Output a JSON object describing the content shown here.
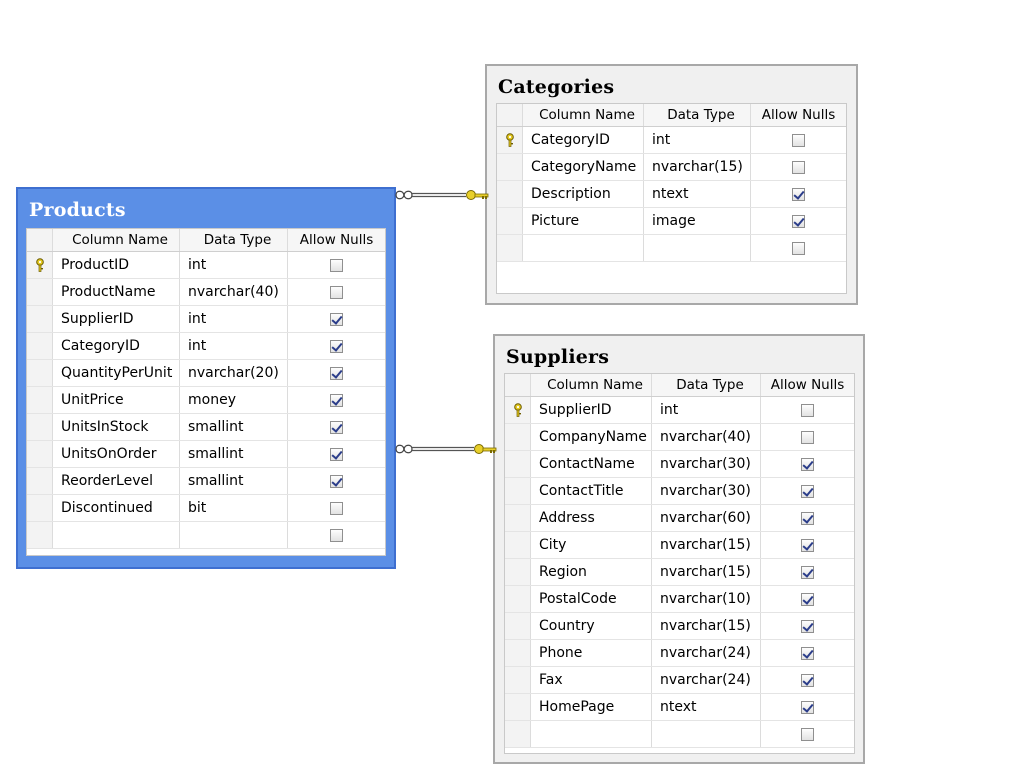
{
  "headers": {
    "column_name": "Column Name",
    "data_type": "Data Type",
    "allow_nulls": "Allow Nulls"
  },
  "tables": {
    "categories": {
      "title": "Categories",
      "rows": [
        {
          "name": "CategoryID",
          "type": "int",
          "nulls": false,
          "pk": true
        },
        {
          "name": "CategoryName",
          "type": "nvarchar(15)",
          "nulls": false,
          "pk": false
        },
        {
          "name": "Description",
          "type": "ntext",
          "nulls": true,
          "pk": false
        },
        {
          "name": "Picture",
          "type": "image",
          "nulls": true,
          "pk": false
        },
        {
          "name": "",
          "type": "",
          "nulls": false,
          "pk": false
        }
      ]
    },
    "products": {
      "title": "Products",
      "selected": true,
      "rows": [
        {
          "name": "ProductID",
          "type": "int",
          "nulls": false,
          "pk": true
        },
        {
          "name": "ProductName",
          "type": "nvarchar(40)",
          "nulls": false,
          "pk": false
        },
        {
          "name": "SupplierID",
          "type": "int",
          "nulls": true,
          "pk": false
        },
        {
          "name": "CategoryID",
          "type": "int",
          "nulls": true,
          "pk": false
        },
        {
          "name": "QuantityPerUnit",
          "type": "nvarchar(20)",
          "nulls": true,
          "pk": false
        },
        {
          "name": "UnitPrice",
          "type": "money",
          "nulls": true,
          "pk": false
        },
        {
          "name": "UnitsInStock",
          "type": "smallint",
          "nulls": true,
          "pk": false
        },
        {
          "name": "UnitsOnOrder",
          "type": "smallint",
          "nulls": true,
          "pk": false
        },
        {
          "name": "ReorderLevel",
          "type": "smallint",
          "nulls": true,
          "pk": false
        },
        {
          "name": "Discontinued",
          "type": "bit",
          "nulls": false,
          "pk": false
        },
        {
          "name": "",
          "type": "",
          "nulls": false,
          "pk": false
        }
      ]
    },
    "suppliers": {
      "title": "Suppliers",
      "rows": [
        {
          "name": "SupplierID",
          "type": "int",
          "nulls": false,
          "pk": true
        },
        {
          "name": "CompanyName",
          "type": "nvarchar(40)",
          "nulls": false,
          "pk": false
        },
        {
          "name": "ContactName",
          "type": "nvarchar(30)",
          "nulls": true,
          "pk": false
        },
        {
          "name": "ContactTitle",
          "type": "nvarchar(30)",
          "nulls": true,
          "pk": false
        },
        {
          "name": "Address",
          "type": "nvarchar(60)",
          "nulls": true,
          "pk": false
        },
        {
          "name": "City",
          "type": "nvarchar(15)",
          "nulls": true,
          "pk": false
        },
        {
          "name": "Region",
          "type": "nvarchar(15)",
          "nulls": true,
          "pk": false
        },
        {
          "name": "PostalCode",
          "type": "nvarchar(10)",
          "nulls": true,
          "pk": false
        },
        {
          "name": "Country",
          "type": "nvarchar(15)",
          "nulls": true,
          "pk": false
        },
        {
          "name": "Phone",
          "type": "nvarchar(24)",
          "nulls": true,
          "pk": false
        },
        {
          "name": "Fax",
          "type": "nvarchar(24)",
          "nulls": true,
          "pk": false
        },
        {
          "name": "HomePage",
          "type": "ntext",
          "nulls": true,
          "pk": false
        },
        {
          "name": "",
          "type": "",
          "nulls": false,
          "pk": false
        }
      ]
    }
  },
  "relationships": [
    {
      "from": "products",
      "to": "categories",
      "many_end": "infinity-icon",
      "one_end": "key-icon"
    },
    {
      "from": "products",
      "to": "suppliers",
      "many_end": "infinity-icon",
      "one_end": "key-icon"
    }
  ],
  "colors": {
    "selected_table": "#5b8fe6",
    "table_frame": "#f0f0f0",
    "key": "#d4b60a"
  }
}
